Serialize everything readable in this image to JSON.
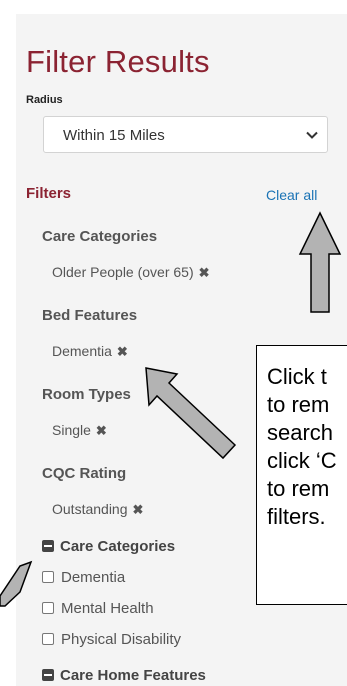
{
  "title": "Filter Results",
  "radius": {
    "label": "Radius",
    "selected": "Within 15 Miles"
  },
  "filters": {
    "heading": "Filters",
    "clear_all": "Clear all",
    "groups": [
      {
        "heading": "Care Categories",
        "chip": "Older People (over 65)"
      },
      {
        "heading": "Bed Features",
        "chip": "Dementia"
      },
      {
        "heading": "Room Types",
        "chip": "Single"
      },
      {
        "heading": "CQC Rating",
        "chip": "Outstanding"
      }
    ],
    "remove_icon": "close-icon"
  },
  "care_categories_section": {
    "heading": "Care Categories",
    "options": [
      "Dementia",
      "Mental Health",
      "Physical Disability"
    ]
  },
  "care_home_features_section": {
    "heading": "Care Home Features"
  },
  "callout": {
    "lines": [
      "Click t",
      "to rem",
      "search",
      "click ‘C",
      "to rem",
      "filters."
    ]
  },
  "colors": {
    "title": "#8b2332",
    "link": "#1a73b5",
    "panel": "#f4f4f4",
    "arrow_fill": "#b3b3b3"
  }
}
